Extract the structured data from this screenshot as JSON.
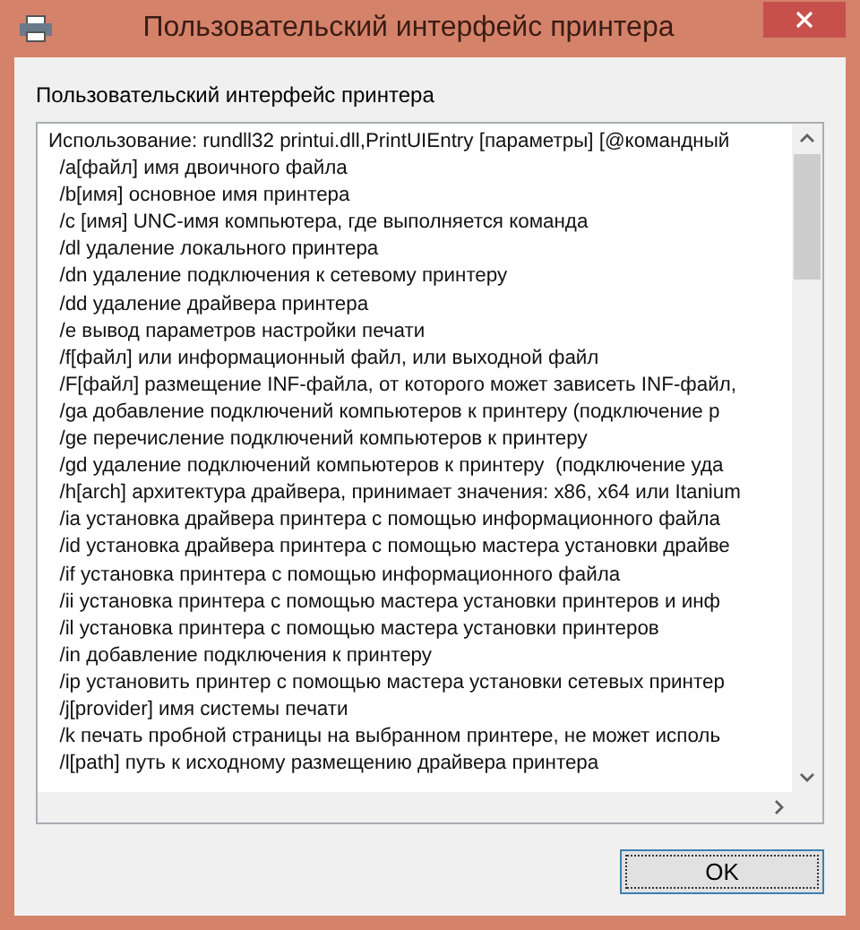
{
  "window": {
    "title": "Пользовательский интерфейс принтера"
  },
  "label": "Пользовательский интерфейс принтера",
  "text_lines": [
    "Использование: rundll32 printui.dll,PrintUIEntry [параметры] [@командный",
    "  /a[файл] имя двоичного файла",
    "  /b[имя] основное имя принтера",
    "  /c [имя] UNC-имя компьютера, где выполняется команда",
    "  /dl удаление локального принтера",
    "  /dn удаление подключения к сетевому принтеру",
    "  /dd удаление драйвера принтера",
    "  /e вывод параметров настройки печати",
    "  /f[файл] или информационный файл, или выходной файл",
    "  /F[файл] размещение INF-файла, от которого может зависеть INF-файл,",
    "  /ga добавление подключений компьютеров к принтеру (подключение р",
    "  /ge перечисление подключений компьютеров к принтеру",
    "  /gd удаление подключений компьютеров к принтеру  (подключение уда",
    "  /h[arch] архитектура драйвера, принимает значения: x86, x64 или Itanium",
    "  /ia установка драйвера принтера с помощью информационного файла",
    "  /id установка драйвера принтера с помощью мастера установки драйве",
    "  /if установка принтера с помощью информационного файла",
    "  /ii установка принтера с помощью мастера установки принтеров и инф",
    "  /il установка принтера с помощью мастера установки принтеров",
    "  /in добавление подключения к принтеру",
    "  /ip установить принтер с помощью мастера установки сетевых принтер",
    "  /j[provider] имя системы печати",
    "  /k печать пробной страницы на выбранном принтере, не может исполь",
    "  /l[path] путь к исходному размещению драйвера принтера"
  ],
  "buttons": [
    {
      "label": "OK"
    }
  ]
}
